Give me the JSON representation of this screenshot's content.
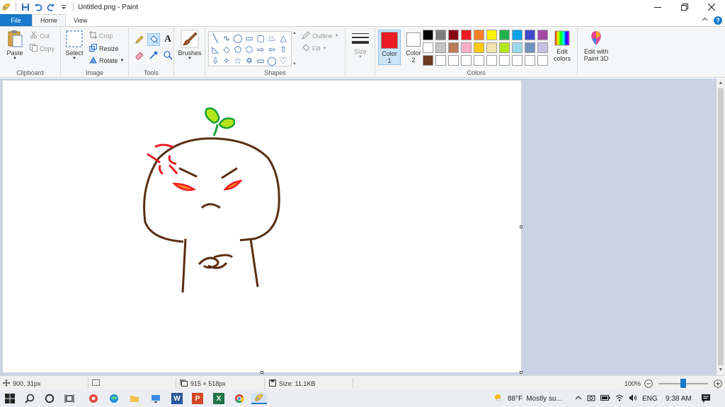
{
  "window": {
    "title": "Untitled.png - Paint"
  },
  "tabs": {
    "file": "File",
    "home": "Home",
    "view": "View"
  },
  "ribbon": {
    "clipboard": {
      "label": "Clipboard",
      "paste": "Paste",
      "cut": "Cut",
      "copy": "Copy"
    },
    "image": {
      "label": "Image",
      "select": "Select",
      "crop": "Crop",
      "resize": "Resize",
      "rotate": "Rotate"
    },
    "tools": {
      "label": "Tools"
    },
    "brushes": {
      "label": "Brushes"
    },
    "shapes": {
      "label": "Shapes",
      "outline": "Outline",
      "fill": "Fill"
    },
    "size": {
      "label": "Size"
    },
    "colors": {
      "label": "Colors",
      "color1_line1": "Color",
      "color1_line2": "1",
      "color2_line1": "Color",
      "color2_line2": "2",
      "color1_value": "#ed1c24",
      "color2_value": "#ffffff",
      "edit_colors_line1": "Edit",
      "edit_colors_line2": "colors",
      "edit_3d_line1": "Edit with",
      "edit_3d_line2": "Paint 3D",
      "palette": [
        "#000000",
        "#7f7f7f",
        "#880015",
        "#ed1c24",
        "#ff7f27",
        "#fff200",
        "#22b14c",
        "#00a2e8",
        "#3f48cc",
        "#a349a4",
        "#ffffff",
        "#c3c3c3",
        "#b97a57",
        "#ffaec9",
        "#ffc90e",
        "#efe4b0",
        "#b5e61d",
        "#99d9ea",
        "#7092be",
        "#c8bfe7",
        "#6b3a1f",
        "#ffffff",
        "#ffffff",
        "#ffffff",
        "#ffffff",
        "#ffffff",
        "#ffffff",
        "#ffffff",
        "#ffffff",
        "#ffffff"
      ]
    }
  },
  "status": {
    "cursor_pos": "900, 31px",
    "canvas_size": "915 × 518px",
    "file_size": "Size: 11.1KB",
    "zoom": "100%"
  },
  "taskbar": {
    "weather_temp": "88°F",
    "weather_text": "Mostly su...",
    "language": "ENG",
    "time": "9:38 AM"
  }
}
